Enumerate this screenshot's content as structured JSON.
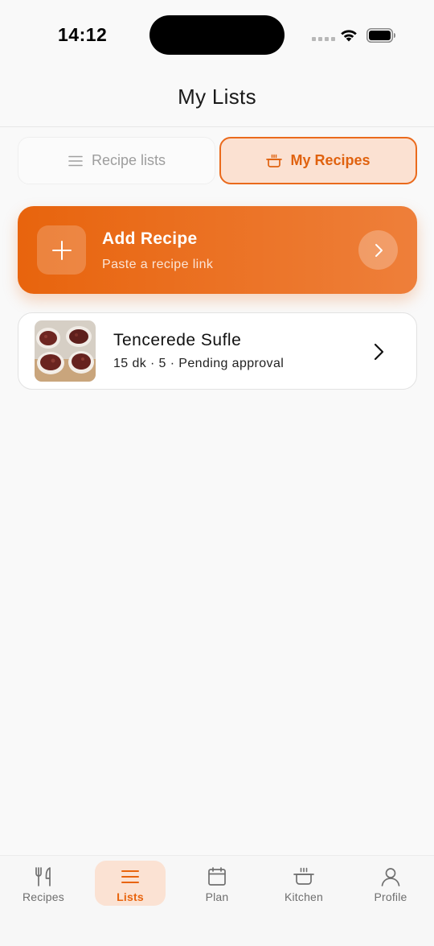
{
  "status_bar": {
    "time": "14:12"
  },
  "nav": {
    "title": "My Lists"
  },
  "segments": [
    {
      "label": "Recipe lists",
      "icon": "list-icon",
      "selected": false
    },
    {
      "label": "My Recipes",
      "icon": "pot-icon",
      "selected": true
    }
  ],
  "add_recipe": {
    "title": "Add Recipe",
    "subtitle": "Paste a recipe link"
  },
  "recipes": [
    {
      "title": "Tencerede Sufle",
      "meta": "15 dk · 5 · Pending approval"
    }
  ],
  "tabs": [
    {
      "label": "Recipes",
      "icon": "fork-knife-icon",
      "active": false
    },
    {
      "label": "Lists",
      "icon": "list-icon",
      "active": true
    },
    {
      "label": "Plan",
      "icon": "calendar-icon",
      "active": false
    },
    {
      "label": "Kitchen",
      "icon": "pot-icon",
      "active": false
    },
    {
      "label": "Profile",
      "icon": "person-icon",
      "active": false
    }
  ],
  "colors": {
    "accent": "#e8640d",
    "accent_light": "#fbe1d2",
    "background": "#f9f9f9",
    "inactive": "#6e6e6e"
  }
}
